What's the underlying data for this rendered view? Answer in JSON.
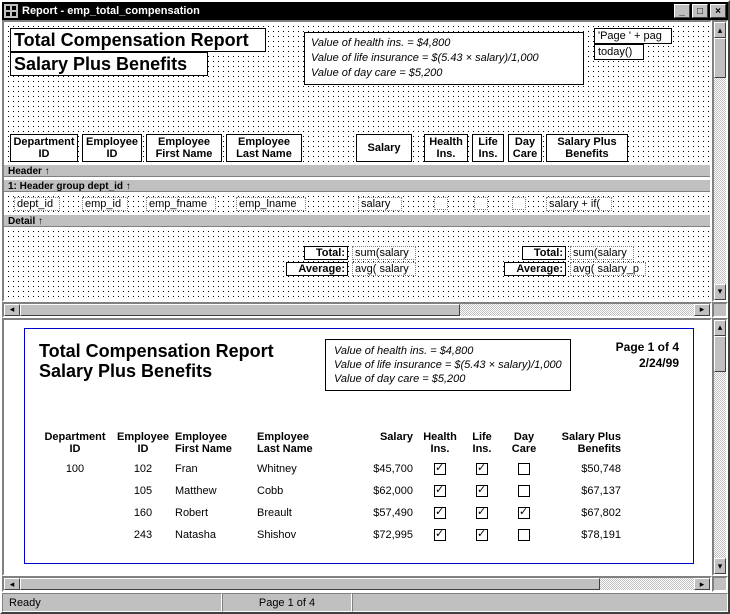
{
  "window": {
    "title": "Report - emp_total_compensation"
  },
  "design": {
    "title1": "Total Compensation Report",
    "title2": "Salary Plus Benefits",
    "notes": {
      "line1": "Value of health ins. = $4,800",
      "line2": "Value of life insurance = $(5.43 × salary)/1,000",
      "line3": "Value of day care = $5,200"
    },
    "expr_page": "'Page ' + pag",
    "expr_today": "today()",
    "columns": {
      "dept": "Department\nID",
      "emp": "Employee\nID",
      "fname": "Employee\nFirst Name",
      "lname": "Employee\nLast Name",
      "salary": "Salary",
      "health": "Health\nIns.",
      "life": "Life\nIns.",
      "daycare": "Day\nCare",
      "plus": "Salary Plus\nBenefits"
    },
    "bands": {
      "header": "Header ↑",
      "group": "1: Header group dept_id ↑",
      "detail": "Detail ↑"
    },
    "fields": {
      "dept": "dept_id",
      "emp": "emp_id",
      "fname": "emp_fname",
      "lname": "emp_lname",
      "salary": "salary",
      "plus": "salary + if("
    },
    "summary": {
      "total_label1": "Total:",
      "total_expr1": "sum(salary",
      "avg_label1": "Average:",
      "avg_expr1": "avg( salary",
      "total_label2": "Total:",
      "total_expr2": "sum(salary",
      "avg_label2": "Average:",
      "avg_expr2": "avg( salary_p"
    }
  },
  "preview": {
    "title1": "Total Compensation Report",
    "title2": "Salary Plus Benefits",
    "page_of": "Page 1 of 4",
    "date": "2/24/99",
    "notes": {
      "line1": "Value of health ins. = $4,800",
      "line2": "Value of life insurance = $(5.43 × salary)/1,000",
      "line3": "Value of day care = $5,200"
    },
    "headers": {
      "dept": "Department\nID",
      "emp": "Employee\nID",
      "fname": "Employee\nFirst Name",
      "lname": "Employee\nLast Name",
      "salary": "Salary",
      "health": "Health\nIns.",
      "life": "Life\nIns.",
      "daycare": "Day\nCare",
      "plus": "Salary Plus\nBenefits"
    },
    "dept": "100",
    "rows": [
      {
        "emp": "102",
        "fn": "Fran",
        "ln": "Whitney",
        "sal": "$45,700",
        "h": true,
        "l": true,
        "d": false,
        "plus": "$50,748"
      },
      {
        "emp": "105",
        "fn": "Matthew",
        "ln": "Cobb",
        "sal": "$62,000",
        "h": true,
        "l": true,
        "d": false,
        "plus": "$67,137"
      },
      {
        "emp": "160",
        "fn": "Robert",
        "ln": "Breault",
        "sal": "$57,490",
        "h": true,
        "l": true,
        "d": true,
        "plus": "$67,802"
      },
      {
        "emp": "243",
        "fn": "Natasha",
        "ln": "Shishov",
        "sal": "$72,995",
        "h": true,
        "l": true,
        "d": false,
        "plus": "$78,191"
      }
    ]
  },
  "status": {
    "ready": "Ready",
    "page": "Page 1 of 4"
  }
}
